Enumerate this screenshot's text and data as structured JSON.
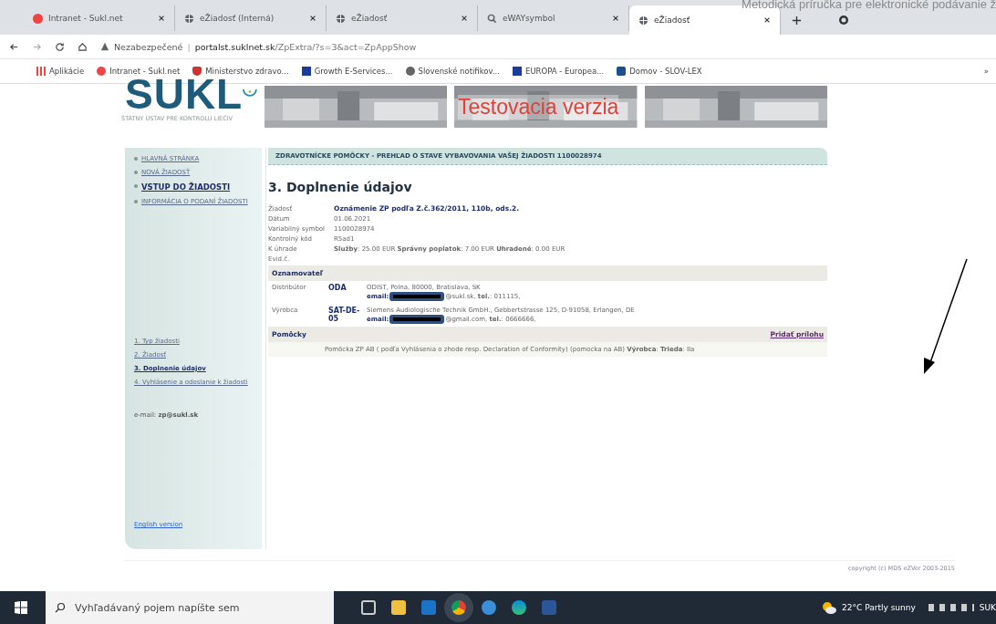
{
  "overlay_caption": "Metodická príručka pre elektronické podávanie ž",
  "tabs": [
    {
      "title": "Intranet - Sukl.net",
      "kind": "site",
      "selected": false
    },
    {
      "title": "eŽiadosť (Interná)",
      "kind": "globe",
      "selected": false
    },
    {
      "title": "eŽiadosť",
      "kind": "globe",
      "selected": false
    },
    {
      "title": "eWAYsymbol",
      "kind": "search",
      "selected": false
    },
    {
      "title": "eŽiadosť",
      "kind": "globe",
      "selected": true
    }
  ],
  "address": {
    "warning": "Nezabezpečené",
    "separator": "|",
    "host": "portalst.suklnet.sk",
    "path": "/ZpExtra/?s=3&act=ZpAppShow"
  },
  "bookmarks": [
    {
      "label": "Aplikácie",
      "kind": "apps"
    },
    {
      "label": "Intranet - Sukl.net",
      "kind": "site"
    },
    {
      "label": "Ministerstvo zdravo...",
      "kind": "shield"
    },
    {
      "label": "Growth E-Services...",
      "kind": "flag"
    },
    {
      "label": "Slovenské notifikov...",
      "kind": "globe"
    },
    {
      "label": "EUROPA - Europea...",
      "kind": "flag"
    },
    {
      "label": "Domov - SLOV-LEX",
      "kind": "square"
    }
  ],
  "bookmarks_more": "»",
  "logo": {
    "name": "SUKL",
    "subtitle": "ŠTÁTNY ÚSTAV PRE KONTROLU LIEČIV"
  },
  "banner_label": "Testovacia verzia",
  "menu": [
    {
      "label": "HLAVNÁ STRÁNKA",
      "selected": false
    },
    {
      "label": "NOVÁ ŽIADOSŤ",
      "selected": false
    },
    {
      "label": "VSTUP DO ŽIADOSTI",
      "selected": true
    },
    {
      "label": "INFORMÁCIA O PODANÍ ŽIADOSTI",
      "selected": false
    }
  ],
  "steps": [
    {
      "label": "1. Typ žiadosti",
      "selected": false
    },
    {
      "label": "2. Žiadosť",
      "selected": false
    },
    {
      "label": "3. Doplnenie údajov",
      "selected": true
    },
    {
      "label": "4. Vyhlásenie a odoslanie k žiadosti",
      "selected": false
    }
  ],
  "contact": "e-mail: **zp@sukl.sk**",
  "english_link": "English version",
  "header_bar": "ZDRAVOTNÍCKE POMÔCKY - PREHĽAD O STAVE VYBAVOVANIA VAŠEJ ŽIADOSTI 1100028974",
  "page_title": "3. Doplnenie údajov",
  "fields": [
    {
      "label": "Žiadosť",
      "value": "Oznámenie ZP podľa Z.č.362/2011, 110b, ods.2.",
      "kind": "bold"
    },
    {
      "label": "Dátum",
      "value": "01.06.2021",
      "kind": "plain"
    },
    {
      "label": "Variabilný symbol",
      "value": "1100028974",
      "kind": "plain"
    },
    {
      "label": "Kontrolný kód",
      "value": "R5ad1",
      "kind": "plain"
    },
    {
      "label": "K úhrade",
      "value": "**Služby**: 25.00 EUR **Správny poplatok**: 7.00 EUR **Uhradené**: 0.00 EUR",
      "kind": "plain"
    },
    {
      "label": "Evid.č."
    }
  ],
  "notifier": {
    "heading": "Oznamovateľ",
    "rows": [
      {
        "role": "Distribútor",
        "code": "ODA",
        "address": "ODIST, Polna, 80000, Bratislava, SK",
        "email_label": "email:",
        "email_rest": "@sukl.sk, **tel.**: 011115,"
      },
      {
        "role": "Výrobca",
        "code": "SAT-DE-05",
        "address": "Siemens Audiologische Technik GmbH., Gebbertstrasse 125, D-91058, Erlangen, DE",
        "email_label": "email:",
        "email_rest": "@gmail.com, **tel.**: 0666666,"
      }
    ]
  },
  "devices": {
    "heading": "Pomôcky",
    "add_link": "Pridať prílohu",
    "items": [
      "Pomôcka ZP AB ( podľa Vyhlásenia o zhode resp. Declaration of Conformity) (pomocka na AB) **Výrobca**: **Trieda**: IIa"
    ]
  },
  "footer": "copyright (c) MDS eZVer 2003-2015",
  "taskbar": {
    "search_placeholder": "Vyhľadávaný pojem napíšte sem",
    "weather": "22°C  Partly sunny",
    "tray_text": "SUK"
  }
}
